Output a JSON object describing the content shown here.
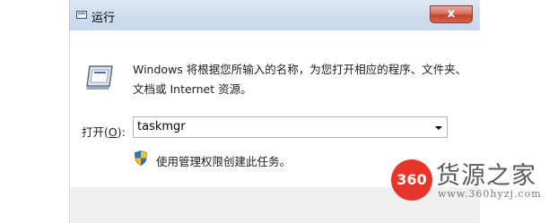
{
  "window": {
    "title": "运行",
    "close_label": "x",
    "close_color": "#c2432b"
  },
  "dialog": {
    "description": "Windows 将根据您所输入的名称，为您打开相应的程序、文件夹、文档或 Internet 资源。",
    "open_label_prefix": "打开(",
    "open_label_accel": "O",
    "open_label_suffix": "):",
    "command_value": "taskmgr",
    "admin_note": "使用管理权限创建此任务。",
    "icons": [
      "run-program-icon",
      "uac-shield-icon",
      "dropdown-arrow-icon"
    ]
  },
  "watermark": {
    "logo_text": "360",
    "title": "货源之家",
    "url": "www.360hyzj.com",
    "logo_color": "#e8352b"
  }
}
